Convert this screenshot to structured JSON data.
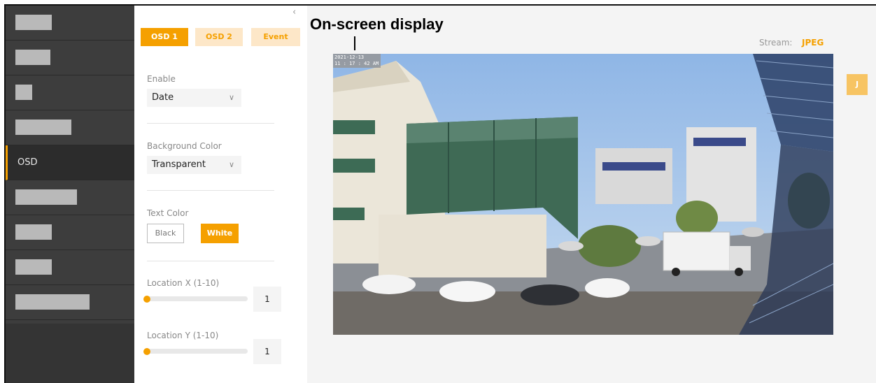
{
  "nav": {
    "items": [
      {
        "label": "",
        "redacted": true
      },
      {
        "label": "",
        "redacted": true
      },
      {
        "label": "",
        "redacted": true
      },
      {
        "label": "",
        "redacted": true
      },
      {
        "label": "OSD",
        "active": true
      },
      {
        "label": "",
        "redacted": true
      },
      {
        "label": "",
        "redacted": true
      },
      {
        "label": "",
        "redacted": true
      },
      {
        "label": "",
        "redacted": true
      }
    ]
  },
  "panel": {
    "collapse_icon": "chevron-left-icon",
    "tabs": [
      {
        "label": "OSD 1",
        "active": true
      },
      {
        "label": "OSD 2",
        "active": false
      },
      {
        "label": "Event",
        "active": false
      }
    ],
    "enable": {
      "label": "Enable",
      "value": "Date"
    },
    "background_color": {
      "label": "Background Color",
      "value": "Transparent"
    },
    "text_color": {
      "label": "Text Color",
      "options": [
        "Black",
        "White"
      ],
      "selected": "White"
    },
    "location_x": {
      "label": "Location X (1-10)",
      "value": "1",
      "level": 0
    },
    "location_y": {
      "label": "Location Y (1-10)",
      "value": "1",
      "level": 0
    }
  },
  "main": {
    "stream_label": "Stream:",
    "stream_value": "JPEG",
    "side_badge": "J",
    "osd_stamp": {
      "date": "2021-12-13",
      "time": "11 : 17 : 42 AM"
    }
  },
  "annotation": {
    "title": "On-screen display"
  },
  "colors": {
    "accent": "#f5a000",
    "nav_bg": "#3d3d3d"
  }
}
